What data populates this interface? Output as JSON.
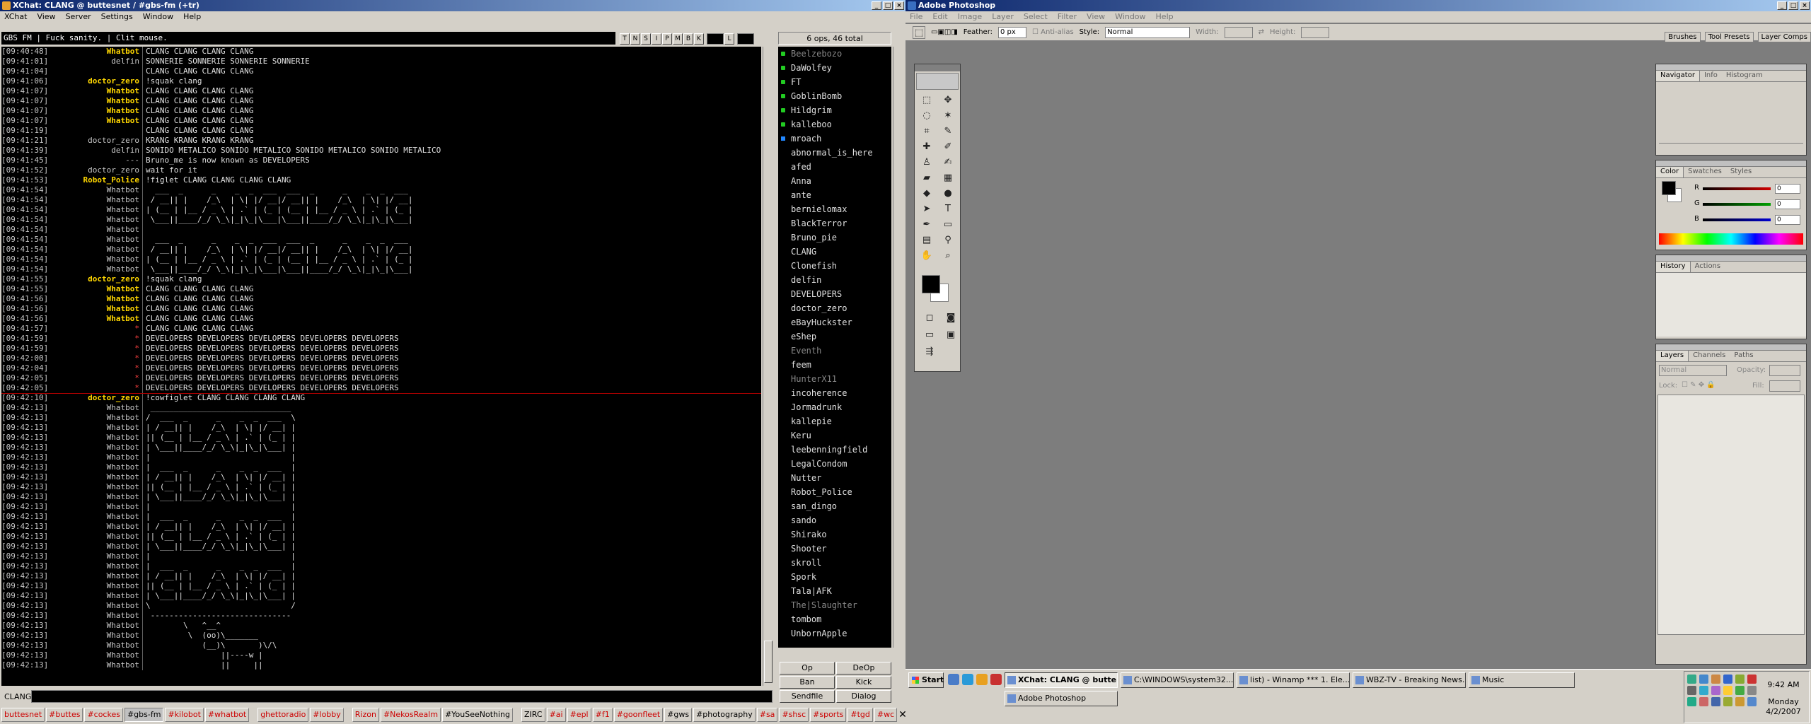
{
  "xchat": {
    "title": "XChat: CLANG @ buttesnet / #gbs-fm (+tr)",
    "menu": [
      "XChat",
      "View",
      "Server",
      "Settings",
      "Window",
      "Help"
    ],
    "topic": "GBS FM | Fuck sanity. | Clit mouse.",
    "mode_buttons": [
      "T",
      "N",
      "S",
      "I",
      "P",
      "M",
      "B",
      "K",
      "L"
    ],
    "ops_count": "6 ops, 46 total",
    "lines": [
      {
        "ts": "[09:40:48]",
        "nick": "Whatbot",
        "msg": "CLANG CLANG CLANG CLANG",
        "nc": "#ffd700",
        "b": true
      },
      {
        "ts": "[09:41:01]",
        "nick": "delfin",
        "msg": "SONNERIE SONNERIE SONNERIE SONNERIE",
        "nc": "#c8c8c8",
        "b": false
      },
      {
        "ts": "[09:41:04]",
        "nick": "",
        "msg": "CLANG CLANG CLANG CLANG",
        "nc": "#c8c8c8",
        "b": false
      },
      {
        "ts": "[09:41:06]",
        "nick": "doctor_zero",
        "msg": "!squak clang",
        "nc": "#ffd700",
        "b": true
      },
      {
        "ts": "[09:41:07]",
        "nick": "Whatbot",
        "msg": "CLANG CLANG CLANG CLANG",
        "nc": "#ffd700",
        "b": true
      },
      {
        "ts": "[09:41:07]",
        "nick": "Whatbot",
        "msg": "CLANG CLANG CLANG CLANG",
        "nc": "#ffd700",
        "b": true
      },
      {
        "ts": "[09:41:07]",
        "nick": "Whatbot",
        "msg": "CLANG CLANG CLANG CLANG",
        "nc": "#ffd700",
        "b": true
      },
      {
        "ts": "[09:41:07]",
        "nick": "Whatbot",
        "msg": "CLANG CLANG CLANG CLANG",
        "nc": "#ffd700",
        "b": true
      },
      {
        "ts": "[09:41:19]",
        "nick": "",
        "msg": "CLANG CLANG CLANG CLANG",
        "nc": "#c8c8c8",
        "b": false
      },
      {
        "ts": "[09:41:21]",
        "nick": "doctor_zero",
        "msg": "KRANG KRANG KRANG KRANG",
        "nc": "#c8c8c8",
        "b": false
      },
      {
        "ts": "[09:41:39]",
        "nick": "delfin",
        "msg": "SONIDO METALICO SONIDO METALICO SONIDO METALICO SONIDO METALICO",
        "nc": "#c8c8c8",
        "b": false
      },
      {
        "ts": "[09:41:45]",
        "nick": "---",
        "msg": "Bruno_me is now known as DEVELOPERS",
        "nc": "#c8c8c8",
        "b": false
      },
      {
        "ts": "[09:41:52]",
        "nick": "doctor_zero",
        "msg": "wait for it",
        "nc": "#c8c8c8",
        "b": false
      },
      {
        "ts": "[09:41:53]",
        "nick": "Robot_Police",
        "msg": "!figlet CLANG CLANG CLANG CLANG",
        "nc": "#ffd700",
        "b": true
      },
      {
        "ts": "[09:41:54]",
        "nick": "Whatbot",
        "msg": "  ___  _      _    _  _  ___  ___  _      _    _  _  ___",
        "nc": "#c8c8c8",
        "b": false
      },
      {
        "ts": "[09:41:54]",
        "nick": "Whatbot",
        "msg": " / __|| |    /_\\  | \\| |/ __|/ __|| |    /_\\  | \\| |/ __|",
        "nc": "#c8c8c8",
        "b": false
      },
      {
        "ts": "[09:41:54]",
        "nick": "Whatbot",
        "msg": "| (__ | |__ / _ \\ | .` | (_ | (__ | |__ / _ \\ | .` | (_ |",
        "nc": "#c8c8c8",
        "b": false
      },
      {
        "ts": "[09:41:54]",
        "nick": "Whatbot",
        "msg": " \\___||____/_/ \\_\\|_|\\_|\\___|\\___||____/_/ \\_\\|_|\\_|\\___|",
        "nc": "#c8c8c8",
        "b": false
      },
      {
        "ts": "[09:41:54]",
        "nick": "Whatbot",
        "msg": "",
        "nc": "#c8c8c8",
        "b": false
      },
      {
        "ts": "[09:41:54]",
        "nick": "Whatbot",
        "msg": "  ___  _      _    _  _  ___  ___  _      _    _  _  ___",
        "nc": "#c8c8c8",
        "b": false
      },
      {
        "ts": "[09:41:54]",
        "nick": "Whatbot",
        "msg": " / __|| |    /_\\  | \\| |/ __|/ __|| |    /_\\  | \\| |/ __|",
        "nc": "#c8c8c8",
        "b": false
      },
      {
        "ts": "[09:41:54]",
        "nick": "Whatbot",
        "msg": "| (__ | |__ / _ \\ | .` | (_ | (__ | |__ / _ \\ | .` | (_ |",
        "nc": "#c8c8c8",
        "b": false
      },
      {
        "ts": "[09:41:54]",
        "nick": "Whatbot",
        "msg": " \\___||____/_/ \\_\\|_|\\_|\\___|\\___||____/_/ \\_\\|_|\\_|\\___|",
        "nc": "#c8c8c8",
        "b": false
      },
      {
        "ts": "[09:41:55]",
        "nick": "doctor_zero",
        "msg": "!squak clang",
        "nc": "#ffd700",
        "b": true
      },
      {
        "ts": "[09:41:55]",
        "nick": "Whatbot",
        "msg": "CLANG CLANG CLANG CLANG",
        "nc": "#ffd700",
        "b": true
      },
      {
        "ts": "[09:41:56]",
        "nick": "Whatbot",
        "msg": "CLANG CLANG CLANG CLANG",
        "nc": "#ffd700",
        "b": true
      },
      {
        "ts": "[09:41:56]",
        "nick": "Whatbot",
        "msg": "CLANG CLANG CLANG CLANG",
        "nc": "#ffd700",
        "b": true
      },
      {
        "ts": "[09:41:56]",
        "nick": "Whatbot",
        "msg": "CLANG CLANG CLANG CLANG",
        "nc": "#ffd700",
        "b": true
      },
      {
        "ts": "[09:41:57]",
        "nick": "*",
        "msg": "CLANG CLANG CLANG CLANG",
        "nc": "#ff4040",
        "b": false
      },
      {
        "ts": "[09:41:59]",
        "nick": "*",
        "msg": "DEVELOPERS DEVELOPERS DEVELOPERS DEVELOPERS DEVELOPERS",
        "nc": "#ff4040",
        "b": false
      },
      {
        "ts": "[09:41:59]",
        "nick": "*",
        "msg": "DEVELOPERS DEVELOPERS DEVELOPERS DEVELOPERS DEVELOPERS",
        "nc": "#ff4040",
        "b": false
      },
      {
        "ts": "[09:42:00]",
        "nick": "*",
        "msg": "DEVELOPERS DEVELOPERS DEVELOPERS DEVELOPERS DEVELOPERS",
        "nc": "#ff4040",
        "b": false
      },
      {
        "ts": "[09:42:04]",
        "nick": "*",
        "msg": "DEVELOPERS DEVELOPERS DEVELOPERS DEVELOPERS DEVELOPERS",
        "nc": "#ff4040",
        "b": false
      },
      {
        "ts": "[09:42:05]",
        "nick": "*",
        "msg": "DEVELOPERS DEVELOPERS DEVELOPERS DEVELOPERS DEVELOPERS",
        "nc": "#ff4040",
        "b": false
      },
      {
        "ts": "[09:42:05]",
        "nick": "*",
        "msg": "DEVELOPERS DEVELOPERS DEVELOPERS DEVELOPERS DEVELOPERS",
        "nc": "#ff4040",
        "b": false
      },
      {
        "ts": "[09:42:10]",
        "nick": "doctor_zero",
        "msg": "!cowfiglet CLANG CLANG CLANG CLANG",
        "nc": "#ffd700",
        "b": true
      },
      {
        "ts": "[09:42:13]",
        "nick": "Whatbot",
        "msg": " ______________________________",
        "nc": "#c8c8c8",
        "b": false
      },
      {
        "ts": "[09:42:13]",
        "nick": "Whatbot",
        "msg": "/  ___  _      _    _  _  ___  \\",
        "nc": "#c8c8c8",
        "b": false
      },
      {
        "ts": "[09:42:13]",
        "nick": "Whatbot",
        "msg": "| / __|| |    /_\\  | \\| |/ __| |",
        "nc": "#c8c8c8",
        "b": false
      },
      {
        "ts": "[09:42:13]",
        "nick": "Whatbot",
        "msg": "|| (__ | |__ / _ \\ | .` | (_ | |",
        "nc": "#c8c8c8",
        "b": false
      },
      {
        "ts": "[09:42:13]",
        "nick": "Whatbot",
        "msg": "| \\___||____/_/ \\_\\|_|\\_|\\___| |",
        "nc": "#c8c8c8",
        "b": false
      },
      {
        "ts": "[09:42:13]",
        "nick": "Whatbot",
        "msg": "|                              |",
        "nc": "#c8c8c8",
        "b": false
      },
      {
        "ts": "[09:42:13]",
        "nick": "Whatbot",
        "msg": "|  ___  _      _    _  _  ___  |",
        "nc": "#c8c8c8",
        "b": false
      },
      {
        "ts": "[09:42:13]",
        "nick": "Whatbot",
        "msg": "| / __|| |    /_\\  | \\| |/ __| |",
        "nc": "#c8c8c8",
        "b": false
      },
      {
        "ts": "[09:42:13]",
        "nick": "Whatbot",
        "msg": "|| (__ | |__ / _ \\ | .` | (_ | |",
        "nc": "#c8c8c8",
        "b": false
      },
      {
        "ts": "[09:42:13]",
        "nick": "Whatbot",
        "msg": "| \\___||____/_/ \\_\\|_|\\_|\\___| |",
        "nc": "#c8c8c8",
        "b": false
      },
      {
        "ts": "[09:42:13]",
        "nick": "Whatbot",
        "msg": "|                              |",
        "nc": "#c8c8c8",
        "b": false
      },
      {
        "ts": "[09:42:13]",
        "nick": "Whatbot",
        "msg": "|  ___  _      _    _  _  ___  |",
        "nc": "#c8c8c8",
        "b": false
      },
      {
        "ts": "[09:42:13]",
        "nick": "Whatbot",
        "msg": "| / __|| |    /_\\  | \\| |/ __| |",
        "nc": "#c8c8c8",
        "b": false
      },
      {
        "ts": "[09:42:13]",
        "nick": "Whatbot",
        "msg": "|| (__ | |__ / _ \\ | .` | (_ | |",
        "nc": "#c8c8c8",
        "b": false
      },
      {
        "ts": "[09:42:13]",
        "nick": "Whatbot",
        "msg": "| \\___||____/_/ \\_\\|_|\\_|\\___| |",
        "nc": "#c8c8c8",
        "b": false
      },
      {
        "ts": "[09:42:13]",
        "nick": "Whatbot",
        "msg": "|                              |",
        "nc": "#c8c8c8",
        "b": false
      },
      {
        "ts": "[09:42:13]",
        "nick": "Whatbot",
        "msg": "|  ___  _      _    _  _  ___  |",
        "nc": "#c8c8c8",
        "b": false
      },
      {
        "ts": "[09:42:13]",
        "nick": "Whatbot",
        "msg": "| / __|| |    /_\\  | \\| |/ __| |",
        "nc": "#c8c8c8",
        "b": false
      },
      {
        "ts": "[09:42:13]",
        "nick": "Whatbot",
        "msg": "|| (__ | |__ / _ \\ | .` | (_ | |",
        "nc": "#c8c8c8",
        "b": false
      },
      {
        "ts": "[09:42:13]",
        "nick": "Whatbot",
        "msg": "| \\___||____/_/ \\_\\|_|\\_|\\___| |",
        "nc": "#c8c8c8",
        "b": false
      },
      {
        "ts": "[09:42:13]",
        "nick": "Whatbot",
        "msg": "\\                              /",
        "nc": "#c8c8c8",
        "b": false
      },
      {
        "ts": "[09:42:13]",
        "nick": "Whatbot",
        "msg": " ------------------------------",
        "nc": "#c8c8c8",
        "b": false
      },
      {
        "ts": "[09:42:13]",
        "nick": "Whatbot",
        "msg": "        \\   ^__^",
        "nc": "#c8c8c8",
        "b": false
      },
      {
        "ts": "[09:42:13]",
        "nick": "Whatbot",
        "msg": "         \\  (oo)\\_______",
        "nc": "#c8c8c8",
        "b": false
      },
      {
        "ts": "[09:42:13]",
        "nick": "Whatbot",
        "msg": "            (__)\\       )\\/\\",
        "nc": "#c8c8c8",
        "b": false
      },
      {
        "ts": "[09:42:13]",
        "nick": "Whatbot",
        "msg": "                ||----w |",
        "nc": "#c8c8c8",
        "b": false
      },
      {
        "ts": "[09:42:13]",
        "nick": "Whatbot",
        "msg": "                ||     ||",
        "nc": "#c8c8c8",
        "b": false
      }
    ],
    "users": [
      {
        "n": "Beelzebozo",
        "m": "op",
        "away": true
      },
      {
        "n": "DaWolfey",
        "m": "op",
        "away": false
      },
      {
        "n": "FT",
        "m": "op",
        "away": false
      },
      {
        "n": "GoblinBomb",
        "m": "op",
        "away": false
      },
      {
        "n": "Hildgrim",
        "m": "op",
        "away": false
      },
      {
        "n": "kalleboo",
        "m": "op",
        "away": false
      },
      {
        "n": "mroach",
        "m": "voice",
        "away": false
      },
      {
        "n": "abnormal_is_here",
        "m": "",
        "away": false
      },
      {
        "n": "afed",
        "m": "",
        "away": false
      },
      {
        "n": "Anna",
        "m": "",
        "away": false
      },
      {
        "n": "ante",
        "m": "",
        "away": false
      },
      {
        "n": "bernielomax",
        "m": "",
        "away": false
      },
      {
        "n": "BlackTerror",
        "m": "",
        "away": false
      },
      {
        "n": "Bruno_pie",
        "m": "",
        "away": false
      },
      {
        "n": "CLANG",
        "m": "",
        "away": false
      },
      {
        "n": "Clonefish",
        "m": "",
        "away": false
      },
      {
        "n": "delfin",
        "m": "",
        "away": false
      },
      {
        "n": "DEVELOPERS",
        "m": "",
        "away": false
      },
      {
        "n": "doctor_zero",
        "m": "",
        "away": false
      },
      {
        "n": "eBayHuckster",
        "m": "",
        "away": false
      },
      {
        "n": "eShep",
        "m": "",
        "away": false
      },
      {
        "n": "Eventh",
        "m": "",
        "away": true
      },
      {
        "n": "feem",
        "m": "",
        "away": false
      },
      {
        "n": "HunterX11",
        "m": "",
        "away": true
      },
      {
        "n": "incoherence",
        "m": "",
        "away": false
      },
      {
        "n": "Jormadrunk",
        "m": "",
        "away": false
      },
      {
        "n": "kallepie",
        "m": "",
        "away": false
      },
      {
        "n": "Keru",
        "m": "",
        "away": false
      },
      {
        "n": "leebenningfield",
        "m": "",
        "away": false
      },
      {
        "n": "LegalCondom",
        "m": "",
        "away": false
      },
      {
        "n": "Nutter",
        "m": "",
        "away": false
      },
      {
        "n": "Robot_Police",
        "m": "",
        "away": false
      },
      {
        "n": "san_dingo",
        "m": "",
        "away": false
      },
      {
        "n": "sando",
        "m": "",
        "away": false
      },
      {
        "n": "Shirako",
        "m": "",
        "away": false
      },
      {
        "n": "Shooter",
        "m": "",
        "away": false
      },
      {
        "n": "skroll",
        "m": "",
        "away": false
      },
      {
        "n": "Spork",
        "m": "",
        "away": false
      },
      {
        "n": "Tala|AFK",
        "m": "",
        "away": false
      },
      {
        "n": "The|Slaughter",
        "m": "",
        "away": true
      },
      {
        "n": "tombom",
        "m": "",
        "away": false
      },
      {
        "n": "UnbornApple",
        "m": "",
        "away": false
      }
    ],
    "user_buttons": [
      "Op",
      "DeOp",
      "Ban",
      "Kick",
      "Sendfile",
      "Dialog"
    ],
    "input_nick": "CLANG",
    "tabs": [
      {
        "t": "buttesnet",
        "k": "r"
      },
      {
        "t": "#buttes",
        "k": "r"
      },
      {
        "t": "#cockes",
        "k": "r"
      },
      {
        "t": "#gbs-fm",
        "k": "cur"
      },
      {
        "t": "#kilobot",
        "k": "r"
      },
      {
        "t": "#whatbot",
        "k": "r"
      },
      {
        "t": "ghettoradio",
        "k": "gr"
      },
      {
        "t": "#lobby",
        "k": "r"
      },
      {
        "t": "Rizon",
        "k": "gr"
      },
      {
        "t": "#NekosRealm",
        "k": "r"
      },
      {
        "t": "#YouSeeNothing",
        "k": "b"
      },
      {
        "t": "ZIRC",
        "k": "gb"
      },
      {
        "t": "#ai",
        "k": "r"
      },
      {
        "t": "#epl",
        "k": "r"
      },
      {
        "t": "#f1",
        "k": "r"
      },
      {
        "t": "#goonfleet",
        "k": "r"
      },
      {
        "t": "#gws",
        "k": "b"
      },
      {
        "t": "#photography",
        "k": "b"
      },
      {
        "t": "#sa",
        "k": "r"
      },
      {
        "t": "#shsc",
        "k": "r"
      },
      {
        "t": "#sports",
        "k": "r"
      },
      {
        "t": "#tgd",
        "k": "r"
      },
      {
        "t": "#wc",
        "k": "r"
      }
    ],
    "close_glyph": "✕"
  },
  "photoshop": {
    "title": "Adobe Photoshop",
    "menu": [
      "File",
      "Edit",
      "Image",
      "Layer",
      "Select",
      "Filter",
      "View",
      "Window",
      "Help"
    ],
    "options": {
      "feather_label": "Feather:",
      "feather_value": "0 px",
      "antialias_label": "Anti-alias",
      "style_label": "Style:",
      "style_value": "Normal",
      "width_label": "Width:",
      "height_label": "Height:"
    },
    "palette_well": [
      "Brushes",
      "Tool Presets",
      "Layer Comps"
    ],
    "navigator_tabs": [
      "Navigator",
      "Info",
      "Histogram"
    ],
    "color_tabs": [
      "Color",
      "Swatches",
      "Styles"
    ],
    "color_channels": [
      {
        "l": "R",
        "v": "0",
        "c": "#d00000"
      },
      {
        "l": "G",
        "v": "0",
        "c": "#00a000"
      },
      {
        "l": "B",
        "v": "0",
        "c": "#0000d0"
      }
    ],
    "history_tabs": [
      "History",
      "Actions"
    ],
    "layers_tabs": [
      "Layers",
      "Channels",
      "Paths"
    ],
    "layers": {
      "blend": "Normal",
      "opacity_label": "Opacity:",
      "lock_label": "Lock:",
      "fill_label": "Fill:"
    }
  },
  "taskbar": {
    "start": "Start",
    "row1": [
      {
        "t": "XChat: CLANG @ butte...",
        "act": true
      },
      {
        "t": "C:\\WINDOWS\\system32...",
        "act": false
      },
      {
        "t": "list) - Winamp *** 1. Ele...",
        "act": false
      },
      {
        "t": "WBZ-TV - Breaking News...",
        "act": false
      },
      {
        "t": "Music",
        "act": false
      }
    ],
    "row2": [
      {
        "t": "Adobe Photoshop",
        "act": false
      }
    ],
    "time": "9:42 AM",
    "day": "Monday",
    "date": "4/2/2007"
  }
}
